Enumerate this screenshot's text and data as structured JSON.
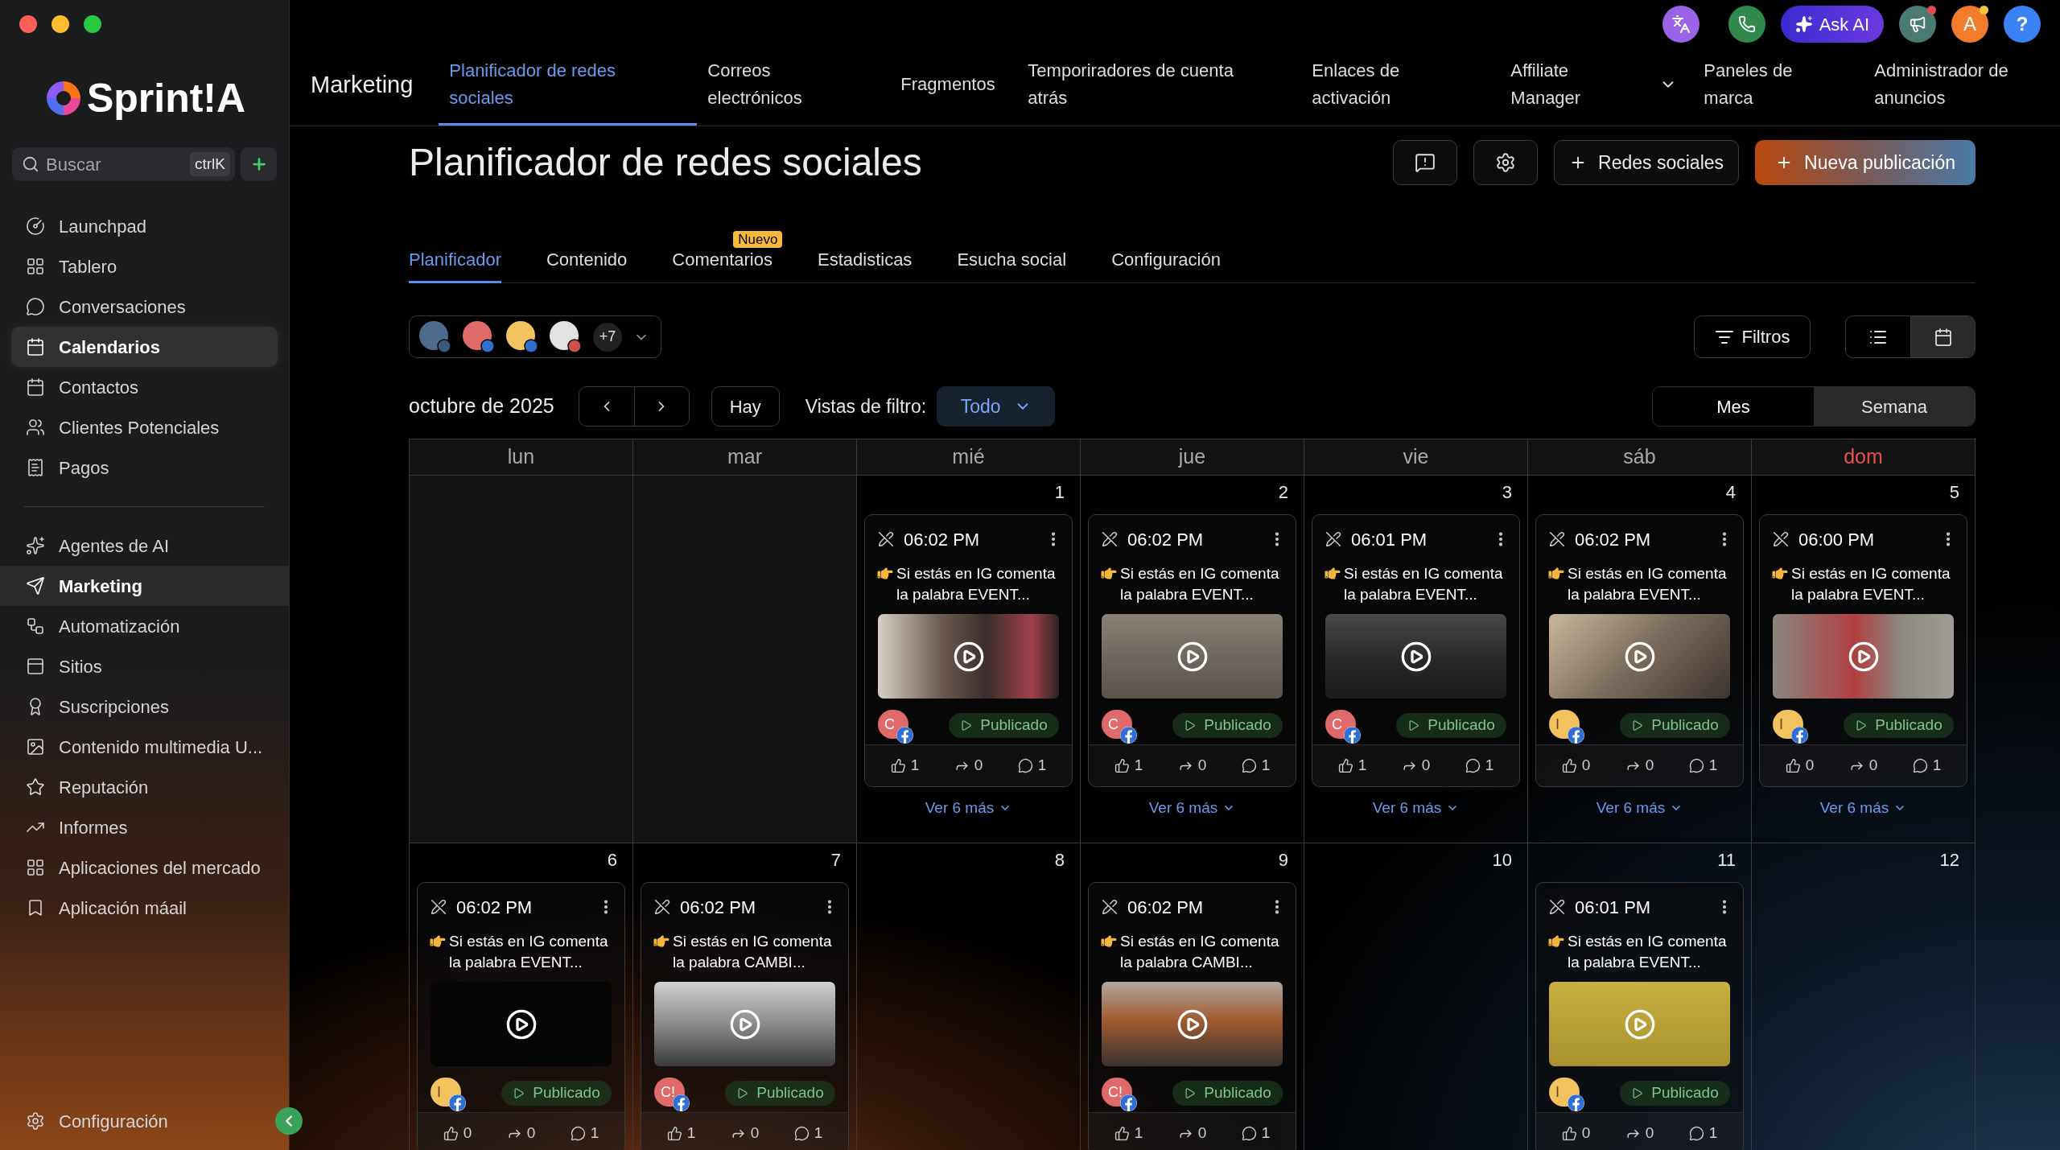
{
  "sidebar": {
    "logo": "Sprint!A",
    "search": {
      "placeholder": "Buscar",
      "shortcut": "ctrlK"
    },
    "groups": [
      {
        "items": [
          {
            "label": "Launchpad",
            "selected": false
          },
          {
            "label": "Tablero",
            "selected": false
          },
          {
            "label": "Conversaciones",
            "selected": false
          },
          {
            "label": "Calendarios",
            "selected": true
          },
          {
            "label": "Contactos",
            "selected": false
          },
          {
            "label": "Clientes Potenciales",
            "selected": false
          },
          {
            "label": "Pagos",
            "selected": false
          }
        ]
      },
      {
        "items": [
          {
            "label": "Agentes de AI",
            "selected": false
          },
          {
            "label": "Marketing",
            "selected": true
          },
          {
            "label": "Automatización",
            "selected": false
          },
          {
            "label": "Sitios",
            "selected": false
          },
          {
            "label": "Suscripciones",
            "selected": false
          },
          {
            "label": "Contenido multimedia U...",
            "selected": false
          },
          {
            "label": "Reputación",
            "selected": false
          },
          {
            "label": "Informes",
            "selected": false
          },
          {
            "label": "Aplicaciones del mercado",
            "selected": false
          },
          {
            "label": "Aplicación máail",
            "selected": false
          }
        ]
      }
    ],
    "footer": {
      "label": "Configuración"
    }
  },
  "topbar": {
    "section": "Marketing",
    "tabs": [
      {
        "label": "Planificador de redes sociales",
        "selected": true,
        "has_menu": false
      },
      {
        "label": "Correos electrónicos",
        "selected": false,
        "has_menu": false
      },
      {
        "label": "Fragmentos",
        "selected": false,
        "has_menu": false
      },
      {
        "label": "Temporiradores de cuenta atrás",
        "selected": false,
        "has_menu": false
      },
      {
        "label": "Enlaces de activación",
        "selected": false,
        "has_menu": false
      },
      {
        "label": "Affiliate Manager",
        "selected": false,
        "has_menu": true
      },
      {
        "label": "Paneles de marca",
        "selected": false,
        "has_menu": false
      },
      {
        "label": "Administrador de anuncios",
        "selected": false,
        "has_menu": false
      }
    ],
    "actions": [
      {
        "kind": "translate"
      },
      {
        "kind": "phone"
      },
      {
        "kind": "ask_ai",
        "label": "Ask AI"
      },
      {
        "kind": "announcements",
        "dot": {
          "color": "#e5484d"
        }
      },
      {
        "kind": "avatar",
        "label": "A",
        "dot": {
          "color": "#f5c542"
        }
      },
      {
        "kind": "help",
        "label": "?"
      }
    ]
  },
  "page": {
    "title": "Planificador de redes sociales",
    "buttons": [
      {
        "kind": "feedback"
      },
      {
        "kind": "settings"
      },
      {
        "kind": "add",
        "label": "Redes sociales"
      },
      {
        "kind": "primary",
        "label": "Nueva publicación"
      }
    ],
    "tabs": [
      {
        "label": "Planificador",
        "selected": true
      },
      {
        "label": "Contenido",
        "selected": false
      },
      {
        "label": "Comentarios",
        "selected": false,
        "badge": "Nuevo"
      },
      {
        "label": "Estadisticas",
        "selected": false
      },
      {
        "label": "Esucha social",
        "selected": false
      },
      {
        "label": "Configuración",
        "selected": false
      }
    ],
    "accounts": {
      "avatars": [
        {
          "color": "#4d6b8c"
        },
        {
          "color": "#e06a6a"
        },
        {
          "color": "#f2c25e"
        },
        {
          "color": "#e2e2e2"
        }
      ],
      "more": "+7"
    },
    "filters_button": "Filtros",
    "view_toggle": [
      {
        "kind": "list",
        "selected": false
      },
      {
        "kind": "calendar",
        "selected": true
      }
    ],
    "month": "octubre de 2025",
    "today_button": "Hay",
    "filter_view": {
      "label": "Vistas de filtro:",
      "value": "Todo"
    },
    "range_toggle": [
      {
        "label": "Mes",
        "selected": true
      },
      {
        "label": "Semana",
        "selected": false
      }
    ]
  },
  "calendar": {
    "weekdays": [
      {
        "label": "lun",
        "highlighted": false
      },
      {
        "label": "mar",
        "highlighted": false
      },
      {
        "label": "mié",
        "highlighted": false
      },
      {
        "label": "jue",
        "highlighted": false
      },
      {
        "label": "vie",
        "highlighted": false
      },
      {
        "label": "sáb",
        "highlighted": false
      },
      {
        "label": "dom",
        "highlighted": true
      }
    ],
    "weeks": [
      {
        "days": [
          {
            "outside": true
          },
          {
            "outside": true
          },
          {
            "outside": false,
            "date": "1",
            "posts": [
              {
                "time": "06:02 PM",
                "text": "Si estás en IG comenta la palabra EVENT...",
                "account": {
                  "initial": "C",
                  "color": "#e06a6a"
                },
                "status": "Publicado",
                "likes": "1",
                "shares": "0",
                "comments": "1"
              }
            ],
            "more": "Ver 6 más"
          },
          {
            "outside": false,
            "date": "2",
            "posts": [
              {
                "time": "06:02 PM",
                "text": "Si estás en IG comenta la palabra EVENT...",
                "account": {
                  "initial": "C",
                  "color": "#e06a6a"
                },
                "status": "Publicado",
                "likes": "1",
                "shares": "0",
                "comments": "1"
              }
            ],
            "more": "Ver 6 más"
          },
          {
            "outside": false,
            "date": "3",
            "posts": [
              {
                "time": "06:01 PM",
                "text": "Si estás en IG comenta la palabra EVENT...",
                "account": {
                  "initial": "C",
                  "color": "#e06a6a"
                },
                "status": "Publicado",
                "likes": "1",
                "shares": "0",
                "comments": "1"
              }
            ],
            "more": "Ver 6 más"
          },
          {
            "outside": false,
            "date": "4",
            "posts": [
              {
                "time": "06:02 PM",
                "text": "Si estás en IG comenta la palabra EVENT...",
                "account": {
                  "initial": "I",
                  "color": "#f2c25e"
                },
                "status": "Publicado",
                "likes": "0",
                "shares": "0",
                "comments": "1"
              }
            ],
            "more": "Ver 6 más"
          },
          {
            "outside": false,
            "date": "5",
            "posts": [
              {
                "time": "06:00 PM",
                "text": "Si estás en IG comenta la palabra EVENT...",
                "account": {
                  "initial": "I",
                  "color": "#f2c25e"
                },
                "status": "Publicado",
                "likes": "0",
                "shares": "0",
                "comments": "1"
              }
            ],
            "more": "Ver 6 más"
          }
        ]
      },
      {
        "days": [
          {
            "outside": false,
            "date": "6",
            "posts": [
              {
                "time": "06:02 PM",
                "text": "Si estás en IG comenta la palabra EVENT...",
                "account": {
                  "initial": "I",
                  "color": "#f2c25e"
                },
                "status": "Publicado",
                "likes": "0",
                "shares": "0",
                "comments": "1"
              }
            ]
          },
          {
            "outside": false,
            "date": "7",
            "posts": [
              {
                "time": "06:02 PM",
                "text": "Si estás en IG comenta la palabra CAMBI...",
                "account": {
                  "initial": "C!",
                  "color": "#e06a6a"
                },
                "status": "Publicado",
                "likes": "1",
                "shares": "0",
                "comments": "1"
              }
            ]
          },
          {
            "outside": false,
            "date": "8"
          },
          {
            "outside": false,
            "date": "9",
            "posts": [
              {
                "time": "06:02 PM",
                "text": "Si estás en IG comenta la palabra CAMBI...",
                "account": {
                  "initial": "C!",
                  "color": "#e06a6a"
                },
                "status": "Publicado",
                "likes": "1",
                "shares": "0",
                "comments": "1"
              }
            ]
          },
          {
            "outside": false,
            "date": "10"
          },
          {
            "outside": false,
            "date": "11",
            "posts": [
              {
                "time": "06:01 PM",
                "text": "Si estás en IG comenta la palabra EVENT...",
                "account": {
                  "initial": "I",
                  "color": "#f2c25e"
                },
                "status": "Publicado",
                "likes": "0",
                "shares": "0",
                "comments": "1"
              }
            ]
          },
          {
            "outside": false,
            "date": "12"
          }
        ]
      }
    ]
  }
}
